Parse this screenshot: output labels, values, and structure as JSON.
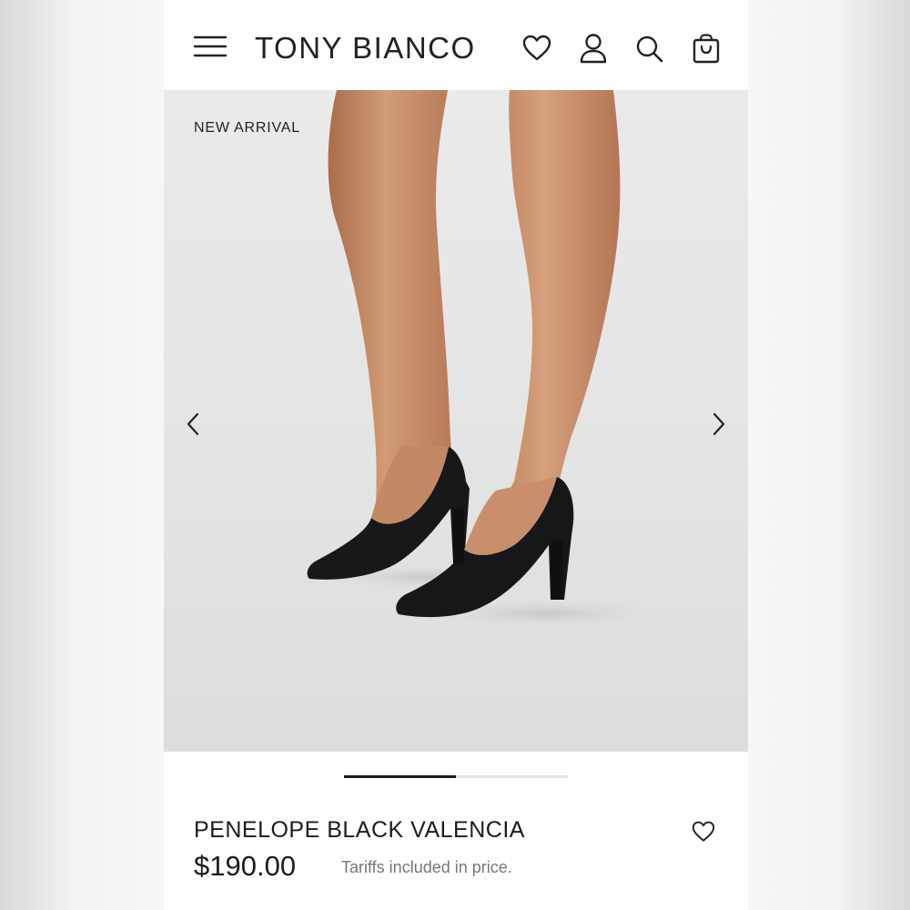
{
  "header": {
    "brand": "TONY BIANCO",
    "icons": [
      "menu-icon",
      "heart-icon",
      "user-icon",
      "search-icon",
      "shopping-bag-icon"
    ]
  },
  "hero": {
    "badge": "NEW ARRIVAL",
    "image_description_icon": "product-photo",
    "carousel_progress": 0.5
  },
  "product": {
    "title": "PENELOPE BLACK VALENCIA",
    "price": "$190.00",
    "tariff_note": "Tariffs included in price."
  },
  "colors": {
    "text": "#1c1c1c",
    "muted": "#777777",
    "hero_bg": "#e3e5e4",
    "shoe": "#151719",
    "skin": "#c48a66"
  }
}
